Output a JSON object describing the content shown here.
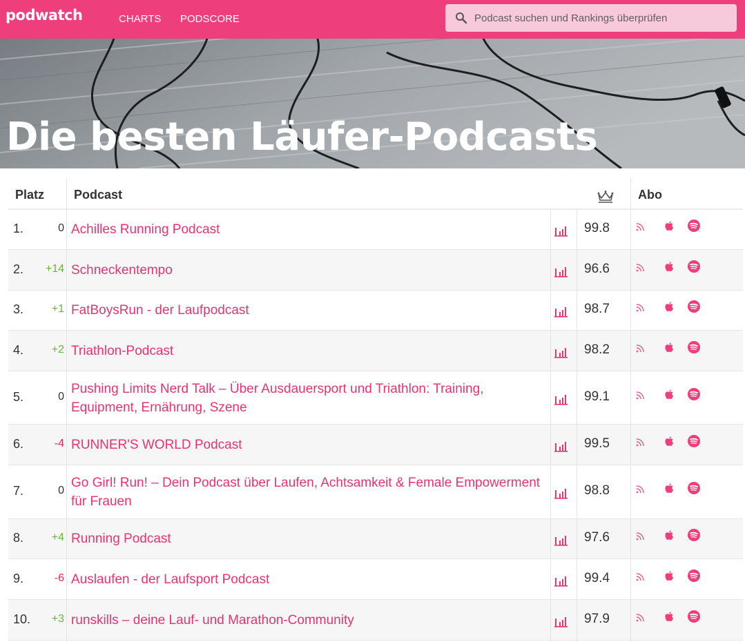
{
  "nav": {
    "logo": "podwatch",
    "links": [
      "CHARTS",
      "PODSCORE"
    ]
  },
  "search": {
    "placeholder": "Podcast suchen und Rankings überprüfen",
    "icon": "search-icon"
  },
  "hero": {
    "title": "Die besten Läufer-Podcasts"
  },
  "table": {
    "headers": {
      "rank": "Platz",
      "podcast": "Podcast",
      "score_icon": "crown-icon",
      "subscribe": "Abo"
    },
    "rows": [
      {
        "rank": "1.",
        "change": "0",
        "trend": "zero",
        "title": "Achilles Running Podcast",
        "score": "99.8"
      },
      {
        "rank": "2.",
        "change": "+14",
        "trend": "pos",
        "title": "Schneckentempo",
        "score": "96.6"
      },
      {
        "rank": "3.",
        "change": "+1",
        "trend": "pos",
        "title": "FatBoysRun - der Laufpodcast",
        "score": "98.7"
      },
      {
        "rank": "4.",
        "change": "+2",
        "trend": "pos",
        "title": "Triathlon-Podcast",
        "score": "98.2"
      },
      {
        "rank": "5.",
        "change": "0",
        "trend": "zero",
        "title": "Pushing Limits Nerd Talk – Über Ausdauersport und Triathlon: Training, Equipment, Ernährung, Szene",
        "score": "99.1"
      },
      {
        "rank": "6.",
        "change": "-4",
        "trend": "neg",
        "title": "RUNNER'S WORLD Podcast",
        "score": "99.5"
      },
      {
        "rank": "7.",
        "change": "0",
        "trend": "zero",
        "title": "Go Girl! Run! – Dein Podcast über Laufen, Achtsamkeit & Female Empowerment für Frauen",
        "score": "98.8"
      },
      {
        "rank": "8.",
        "change": "+4",
        "trend": "pos",
        "title": "Running Podcast",
        "score": "97.6"
      },
      {
        "rank": "9.",
        "change": "-6",
        "trend": "neg",
        "title": "Auslaufen - der Laufsport Podcast",
        "score": "99.4"
      },
      {
        "rank": "10.",
        "change": "+3",
        "trend": "pos",
        "title": "runskills – deine Lauf- und Marathon-Community",
        "score": "97.9"
      }
    ],
    "row_icons": [
      "stats-icon",
      "rss-icon",
      "apple-icon",
      "spotify-icon"
    ]
  },
  "colors": {
    "brand": "#ee3e7b",
    "link": "#e8336f",
    "positive": "#6db33f",
    "negative": "#e0245e"
  }
}
